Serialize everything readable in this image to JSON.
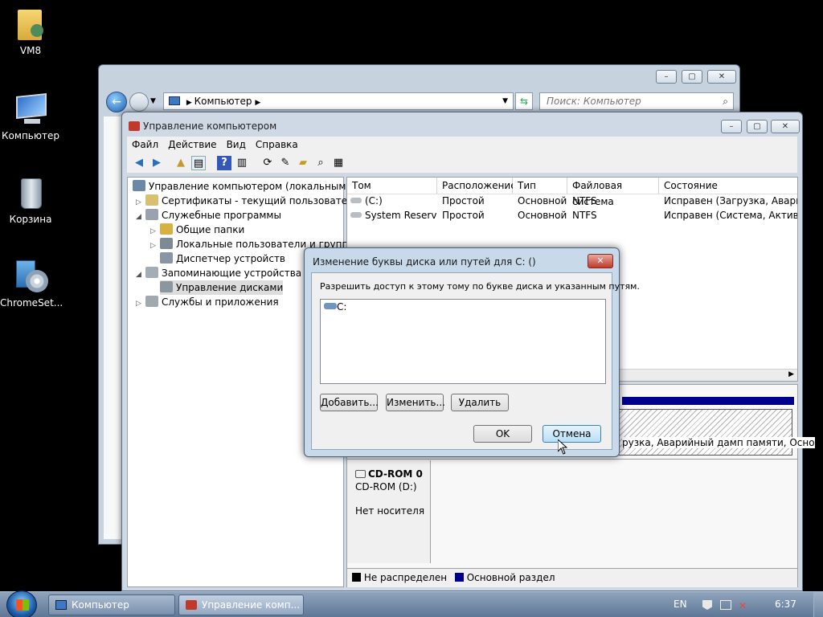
{
  "desktop": {
    "icons": [
      {
        "label": "VM8",
        "icon": "user-folder-icon"
      },
      {
        "label": "Компьютер",
        "icon": "computer-icon"
      },
      {
        "label": "Корзина",
        "icon": "recycle-bin-icon"
      },
      {
        "label": "ChromeSet...",
        "icon": "setup-disc-icon"
      }
    ]
  },
  "explorer": {
    "address": "Компьютер",
    "search_placeholder": "Поиск: Компьютер"
  },
  "mmc": {
    "title": "Управление компьютером",
    "menu": [
      "Файл",
      "Действие",
      "Вид",
      "Справка"
    ],
    "tree": {
      "root": "Управление компьютером (локальным)",
      "items": [
        "Сертификаты - текущий пользователь",
        "Служебные программы",
        "Общие папки",
        "Локальные пользователи и группы",
        "Диспетчер устройств",
        "Запоминающие устройства",
        "Управление дисками",
        "Службы и приложения"
      ]
    },
    "volumes": {
      "columns": [
        "Том",
        "Расположение",
        "Тип",
        "Файловая система",
        "Состояние"
      ],
      "rows": [
        [
          "(C:)",
          "Простой",
          "Основной",
          "NTFS",
          "Исправен (Загрузка, Аварийн"
        ],
        [
          "System Reserved",
          "Простой",
          "Основной",
          "NTFS",
          "Исправен (Система, Активен,"
        ]
      ]
    },
    "disk_partition_text": "рузка, Аварийный дамп памяти, Осно",
    "cdrom": {
      "name": "CD-ROM 0",
      "drive": "CD-ROM (D:)",
      "status": "Нет носителя"
    },
    "legend": [
      "Не распределен",
      "Основной раздел"
    ]
  },
  "dialog": {
    "title": "Изменение буквы диска или путей для C: ()",
    "description": "Разрешить доступ к этому тому по букве диска и указанным путям.",
    "list_items": [
      "C:"
    ],
    "add_label": "Добавить...",
    "change_label": "Изменить...",
    "remove_label": "Удалить",
    "ok_label": "OK",
    "cancel_label": "Отмена"
  },
  "taskbar": {
    "tasks": [
      "Компьютер",
      "Управление комп..."
    ],
    "language": "EN",
    "time": "6:37"
  },
  "colors": {
    "unallocated": "#000000",
    "primary_partition": "#00008b"
  }
}
